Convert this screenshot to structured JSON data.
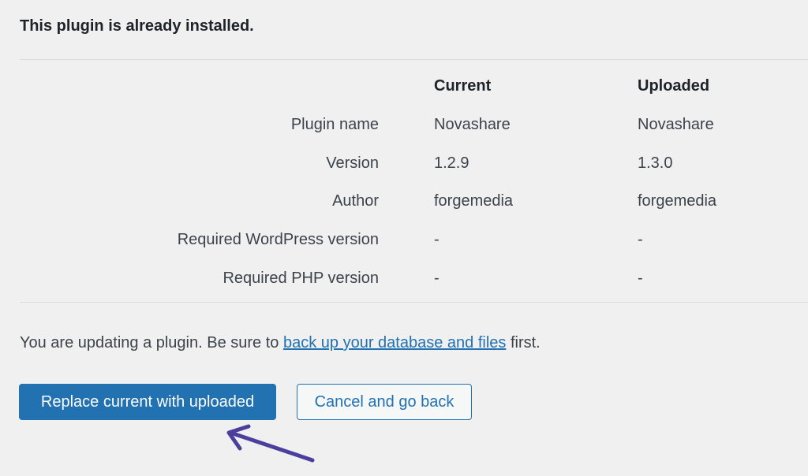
{
  "notice": {
    "heading": "This plugin is already installed."
  },
  "comparison": {
    "columns": {
      "current": "Current",
      "uploaded": "Uploaded"
    },
    "rows": [
      {
        "label": "Plugin name",
        "current": "Novashare",
        "uploaded": "Novashare"
      },
      {
        "label": "Version",
        "current": "1.2.9",
        "uploaded": "1.3.0"
      },
      {
        "label": "Author",
        "current": "forgemedia",
        "uploaded": "forgemedia"
      },
      {
        "label": "Required WordPress version",
        "current": "-",
        "uploaded": "-"
      },
      {
        "label": "Required PHP version",
        "current": "-",
        "uploaded": "-"
      }
    ]
  },
  "warning": {
    "prefix": "You are updating a plugin. Be sure to ",
    "link_text": "back up your database and files",
    "suffix": " first."
  },
  "actions": {
    "replace_label": "Replace current with uploaded",
    "cancel_label": "Cancel and go back"
  },
  "annotation": {
    "icon": "arrow-icon",
    "color": "#4b3f9e"
  },
  "colors": {
    "accent": "#2271b1",
    "background": "#f0f0f1",
    "text": "#3c434a",
    "heading": "#1d2327"
  }
}
